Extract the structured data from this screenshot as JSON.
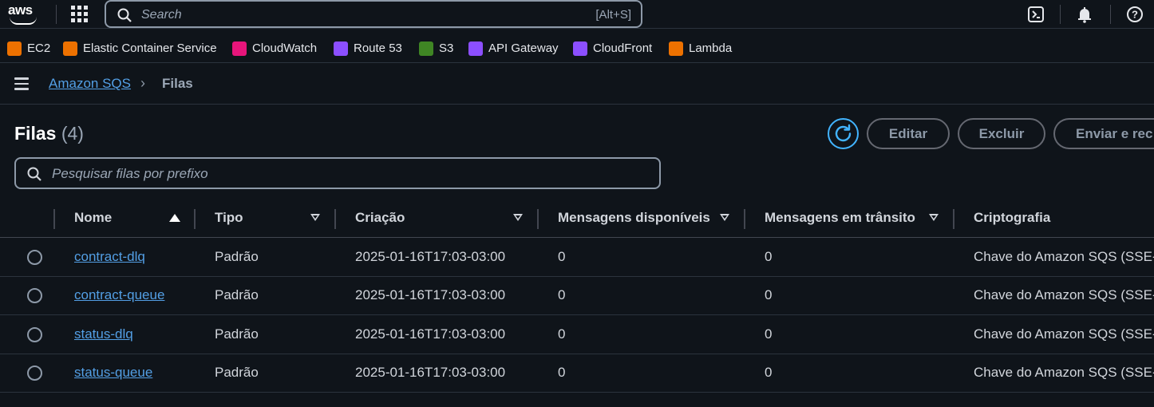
{
  "topnav": {
    "logo_text": "aws",
    "search_placeholder": "Search",
    "search_shortcut": "[Alt+S]",
    "icons": [
      "cloudshell-icon",
      "bell-icon",
      "help-icon"
    ]
  },
  "favorites": [
    {
      "label": "EC2",
      "color": "#ed7100",
      "icon": "ec2-icon"
    },
    {
      "label": "Elastic Container Service",
      "color": "#ed7100",
      "icon": "ecs-icon"
    },
    {
      "label": "CloudWatch",
      "color": "#e7157b",
      "icon": "cloudwatch-icon"
    },
    {
      "label": "Route 53",
      "color": "#8c4fff",
      "icon": "route53-icon"
    },
    {
      "label": "S3",
      "color": "#3f8624",
      "icon": "s3-icon"
    },
    {
      "label": "API Gateway",
      "color": "#8c4fff",
      "icon": "api-gateway-icon"
    },
    {
      "label": "CloudFront",
      "color": "#8c4fff",
      "icon": "cloudfront-icon"
    },
    {
      "label": "Lambda",
      "color": "#ed7100",
      "icon": "lambda-icon"
    }
  ],
  "breadcrumb": {
    "parent": "Amazon SQS",
    "separator": "›",
    "current": "Filas"
  },
  "header": {
    "title": "Filas",
    "count": "(4)",
    "buttons": {
      "edit": "Editar",
      "delete": "Excluir",
      "send": "Enviar e rec"
    }
  },
  "filter": {
    "placeholder": "Pesquisar filas por prefixo"
  },
  "table": {
    "columns": {
      "name": "Nome",
      "type": "Tipo",
      "created": "Criação",
      "available": "Mensagens disponíveis",
      "inflight": "Mensagens em trânsito",
      "encryption": "Criptografia"
    },
    "rows": [
      {
        "name": "contract-dlq",
        "type": "Padrão",
        "created": "2025-01-16T17:03-03:00",
        "available": "0",
        "inflight": "0",
        "encryption": "Chave do Amazon SQS (SSE-"
      },
      {
        "name": "contract-queue",
        "type": "Padrão",
        "created": "2025-01-16T17:03-03:00",
        "available": "0",
        "inflight": "0",
        "encryption": "Chave do Amazon SQS (SSE-"
      },
      {
        "name": "status-dlq",
        "type": "Padrão",
        "created": "2025-01-16T17:03-03:00",
        "available": "0",
        "inflight": "0",
        "encryption": "Chave do Amazon SQS (SSE-"
      },
      {
        "name": "status-queue",
        "type": "Padrão",
        "created": "2025-01-16T17:03-03:00",
        "available": "0",
        "inflight": "0",
        "encryption": "Chave do Amazon SQS (SSE-"
      }
    ]
  },
  "colors": {
    "background": "#0f141a",
    "link": "#539fe5",
    "accent": "#42b4ff"
  }
}
